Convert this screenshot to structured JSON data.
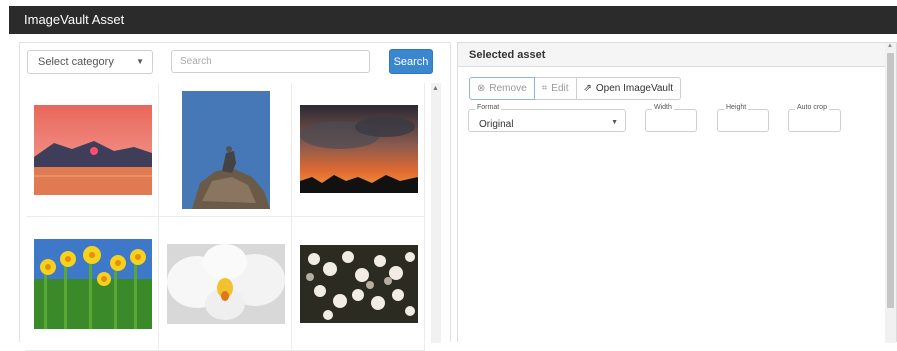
{
  "window": {
    "title": "ImageVault Asset"
  },
  "picker": {
    "category_placeholder": "Select category",
    "search_placeholder": "Search",
    "search_button": "Search"
  },
  "thumbnails": [
    {
      "name": "thumb-sunset-lake",
      "subject": "sunset-lake"
    },
    {
      "name": "thumb-bird-on-rock",
      "subject": "bird-rock"
    },
    {
      "name": "thumb-dramatic-sky",
      "subject": "dramatic-sky"
    },
    {
      "name": "thumb-daffodils",
      "subject": "daffodils"
    },
    {
      "name": "thumb-orchid",
      "subject": "orchid"
    },
    {
      "name": "thumb-blossoms",
      "subject": "blossoms"
    }
  ],
  "selected": {
    "header": "Selected asset",
    "buttons": {
      "remove": "Remove",
      "edit": "Edit",
      "open": "Open ImageVault"
    },
    "format": {
      "label": "Format",
      "value": "Original"
    },
    "width": {
      "label": "Width",
      "value": ""
    },
    "height": {
      "label": "Height",
      "value": ""
    },
    "autocrop": {
      "label": "Auto crop",
      "value": ""
    }
  },
  "colors": {
    "titlebar": "#2b2b2b",
    "search_button": "#3a87cf"
  }
}
